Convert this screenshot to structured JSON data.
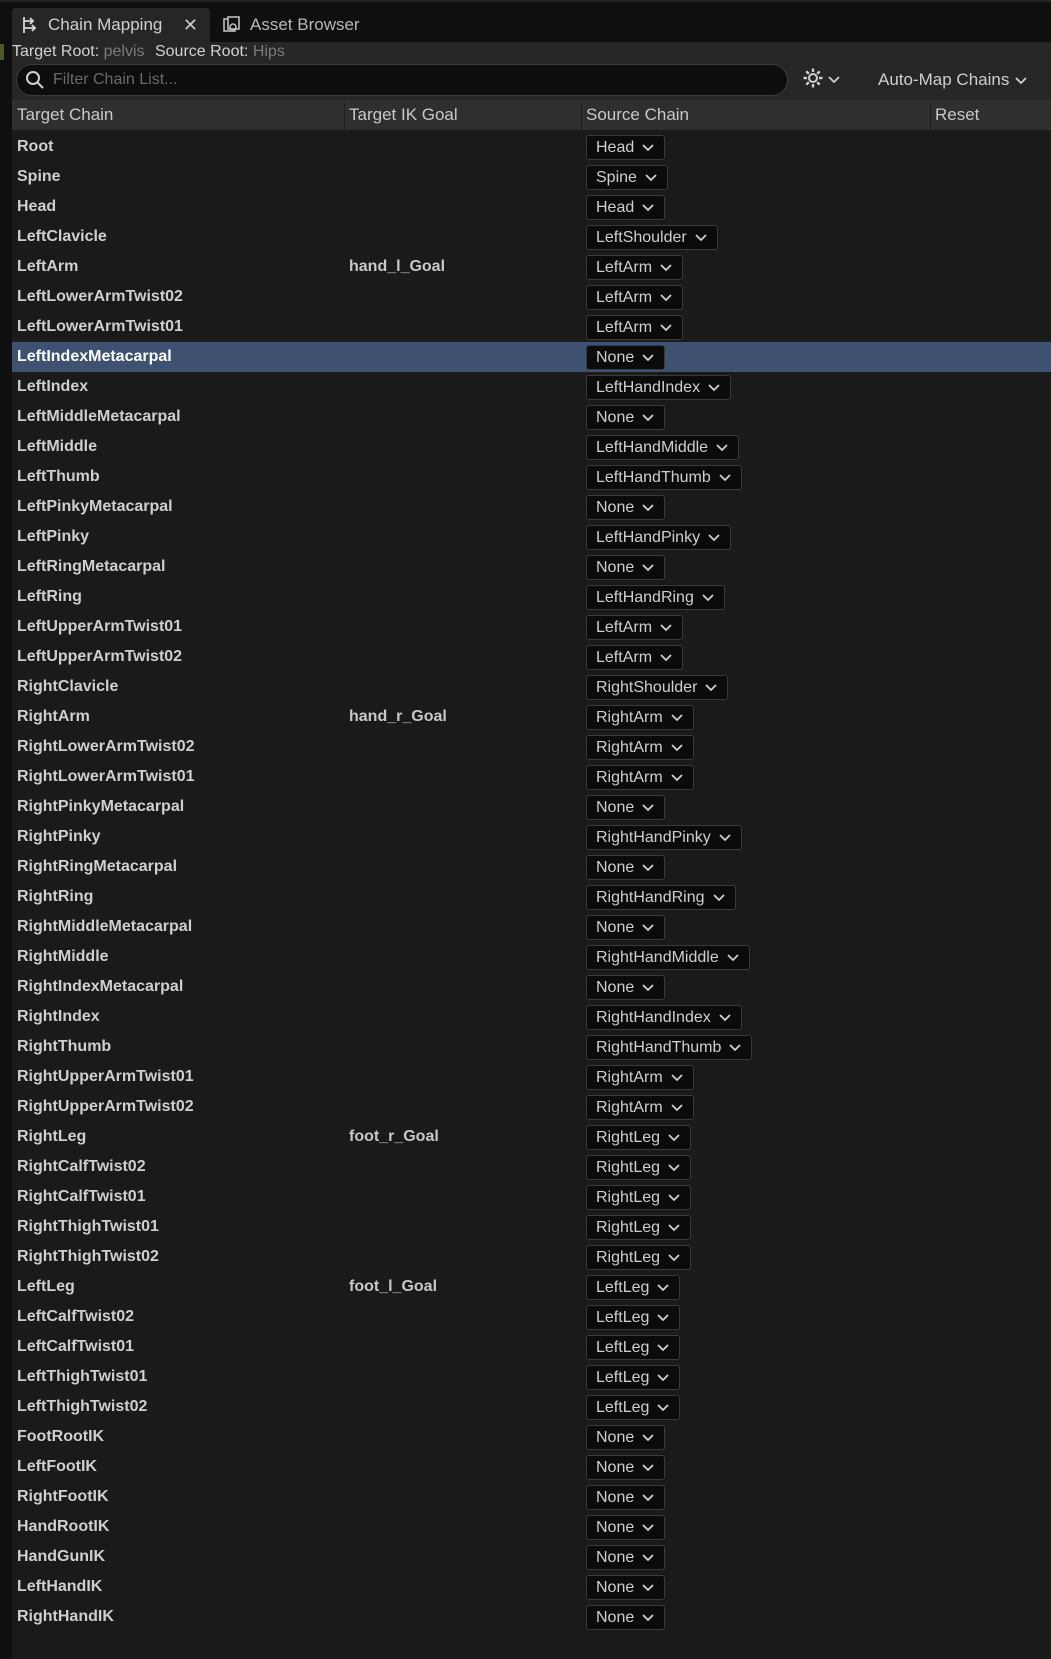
{
  "tabs": [
    {
      "label": "Chain Mapping",
      "active": true,
      "icon": "chain-mapping-icon"
    },
    {
      "label": "Asset Browser",
      "active": false,
      "icon": "asset-browser-icon"
    }
  ],
  "info": {
    "target_root_label": "Target Root:",
    "target_root_value": "pelvis",
    "source_root_label": "Source Root:",
    "source_root_value": "Hips"
  },
  "search": {
    "placeholder": "Filter Chain List..."
  },
  "toolbar": {
    "automap_label": "Auto-Map Chains"
  },
  "columns": {
    "target_chain": "Target Chain",
    "target_ik_goal": "Target IK Goal",
    "source_chain": "Source Chain",
    "reset": "Reset"
  },
  "colors": {
    "selected_row": "#3e5170",
    "panel": "#1a1a1a",
    "header": "#2f2f2f"
  },
  "rows": [
    {
      "target": "Root",
      "goal": "",
      "source": "Head"
    },
    {
      "target": "Spine",
      "goal": "",
      "source": "Spine"
    },
    {
      "target": "Head",
      "goal": "",
      "source": "Head"
    },
    {
      "target": "LeftClavicle",
      "goal": "",
      "source": "LeftShoulder"
    },
    {
      "target": "LeftArm",
      "goal": "hand_l_Goal",
      "source": "LeftArm"
    },
    {
      "target": "LeftLowerArmTwist02",
      "goal": "",
      "source": "LeftArm"
    },
    {
      "target": "LeftLowerArmTwist01",
      "goal": "",
      "source": "LeftArm"
    },
    {
      "target": "LeftIndexMetacarpal",
      "goal": "",
      "source": "None",
      "selected": true
    },
    {
      "target": "LeftIndex",
      "goal": "",
      "source": "LeftHandIndex"
    },
    {
      "target": "LeftMiddleMetacarpal",
      "goal": "",
      "source": "None"
    },
    {
      "target": "LeftMiddle",
      "goal": "",
      "source": "LeftHandMiddle"
    },
    {
      "target": "LeftThumb",
      "goal": "",
      "source": "LeftHandThumb"
    },
    {
      "target": "LeftPinkyMetacarpal",
      "goal": "",
      "source": "None"
    },
    {
      "target": "LeftPinky",
      "goal": "",
      "source": "LeftHandPinky"
    },
    {
      "target": "LeftRingMetacarpal",
      "goal": "",
      "source": "None"
    },
    {
      "target": "LeftRing",
      "goal": "",
      "source": "LeftHandRing"
    },
    {
      "target": "LeftUpperArmTwist01",
      "goal": "",
      "source": "LeftArm"
    },
    {
      "target": "LeftUpperArmTwist02",
      "goal": "",
      "source": "LeftArm"
    },
    {
      "target": "RightClavicle",
      "goal": "",
      "source": "RightShoulder"
    },
    {
      "target": "RightArm",
      "goal": "hand_r_Goal",
      "source": "RightArm"
    },
    {
      "target": "RightLowerArmTwist02",
      "goal": "",
      "source": "RightArm"
    },
    {
      "target": "RightLowerArmTwist01",
      "goal": "",
      "source": "RightArm"
    },
    {
      "target": "RightPinkyMetacarpal",
      "goal": "",
      "source": "None"
    },
    {
      "target": "RightPinky",
      "goal": "",
      "source": "RightHandPinky"
    },
    {
      "target": "RightRingMetacarpal",
      "goal": "",
      "source": "None"
    },
    {
      "target": "RightRing",
      "goal": "",
      "source": "RightHandRing"
    },
    {
      "target": "RightMiddleMetacarpal",
      "goal": "",
      "source": "None"
    },
    {
      "target": "RightMiddle",
      "goal": "",
      "source": "RightHandMiddle"
    },
    {
      "target": "RightIndexMetacarpal",
      "goal": "",
      "source": "None"
    },
    {
      "target": "RightIndex",
      "goal": "",
      "source": "RightHandIndex"
    },
    {
      "target": "RightThumb",
      "goal": "",
      "source": "RightHandThumb"
    },
    {
      "target": "RightUpperArmTwist01",
      "goal": "",
      "source": "RightArm"
    },
    {
      "target": "RightUpperArmTwist02",
      "goal": "",
      "source": "RightArm"
    },
    {
      "target": "RightLeg",
      "goal": "foot_r_Goal",
      "source": "RightLeg"
    },
    {
      "target": "RightCalfTwist02",
      "goal": "",
      "source": "RightLeg"
    },
    {
      "target": "RightCalfTwist01",
      "goal": "",
      "source": "RightLeg"
    },
    {
      "target": "RightThighTwist01",
      "goal": "",
      "source": "RightLeg"
    },
    {
      "target": "RightThighTwist02",
      "goal": "",
      "source": "RightLeg"
    },
    {
      "target": "LeftLeg",
      "goal": "foot_l_Goal",
      "source": "LeftLeg"
    },
    {
      "target": "LeftCalfTwist02",
      "goal": "",
      "source": "LeftLeg"
    },
    {
      "target": "LeftCalfTwist01",
      "goal": "",
      "source": "LeftLeg"
    },
    {
      "target": "LeftThighTwist01",
      "goal": "",
      "source": "LeftLeg"
    },
    {
      "target": "LeftThighTwist02",
      "goal": "",
      "source": "LeftLeg"
    },
    {
      "target": "FootRootIK",
      "goal": "",
      "source": "None"
    },
    {
      "target": "LeftFootIK",
      "goal": "",
      "source": "None"
    },
    {
      "target": "RightFootIK",
      "goal": "",
      "source": "None"
    },
    {
      "target": "HandRootIK",
      "goal": "",
      "source": "None"
    },
    {
      "target": "HandGunIK",
      "goal": "",
      "source": "None"
    },
    {
      "target": "LeftHandIK",
      "goal": "",
      "source": "None"
    },
    {
      "target": "RightHandIK",
      "goal": "",
      "source": "None"
    }
  ]
}
